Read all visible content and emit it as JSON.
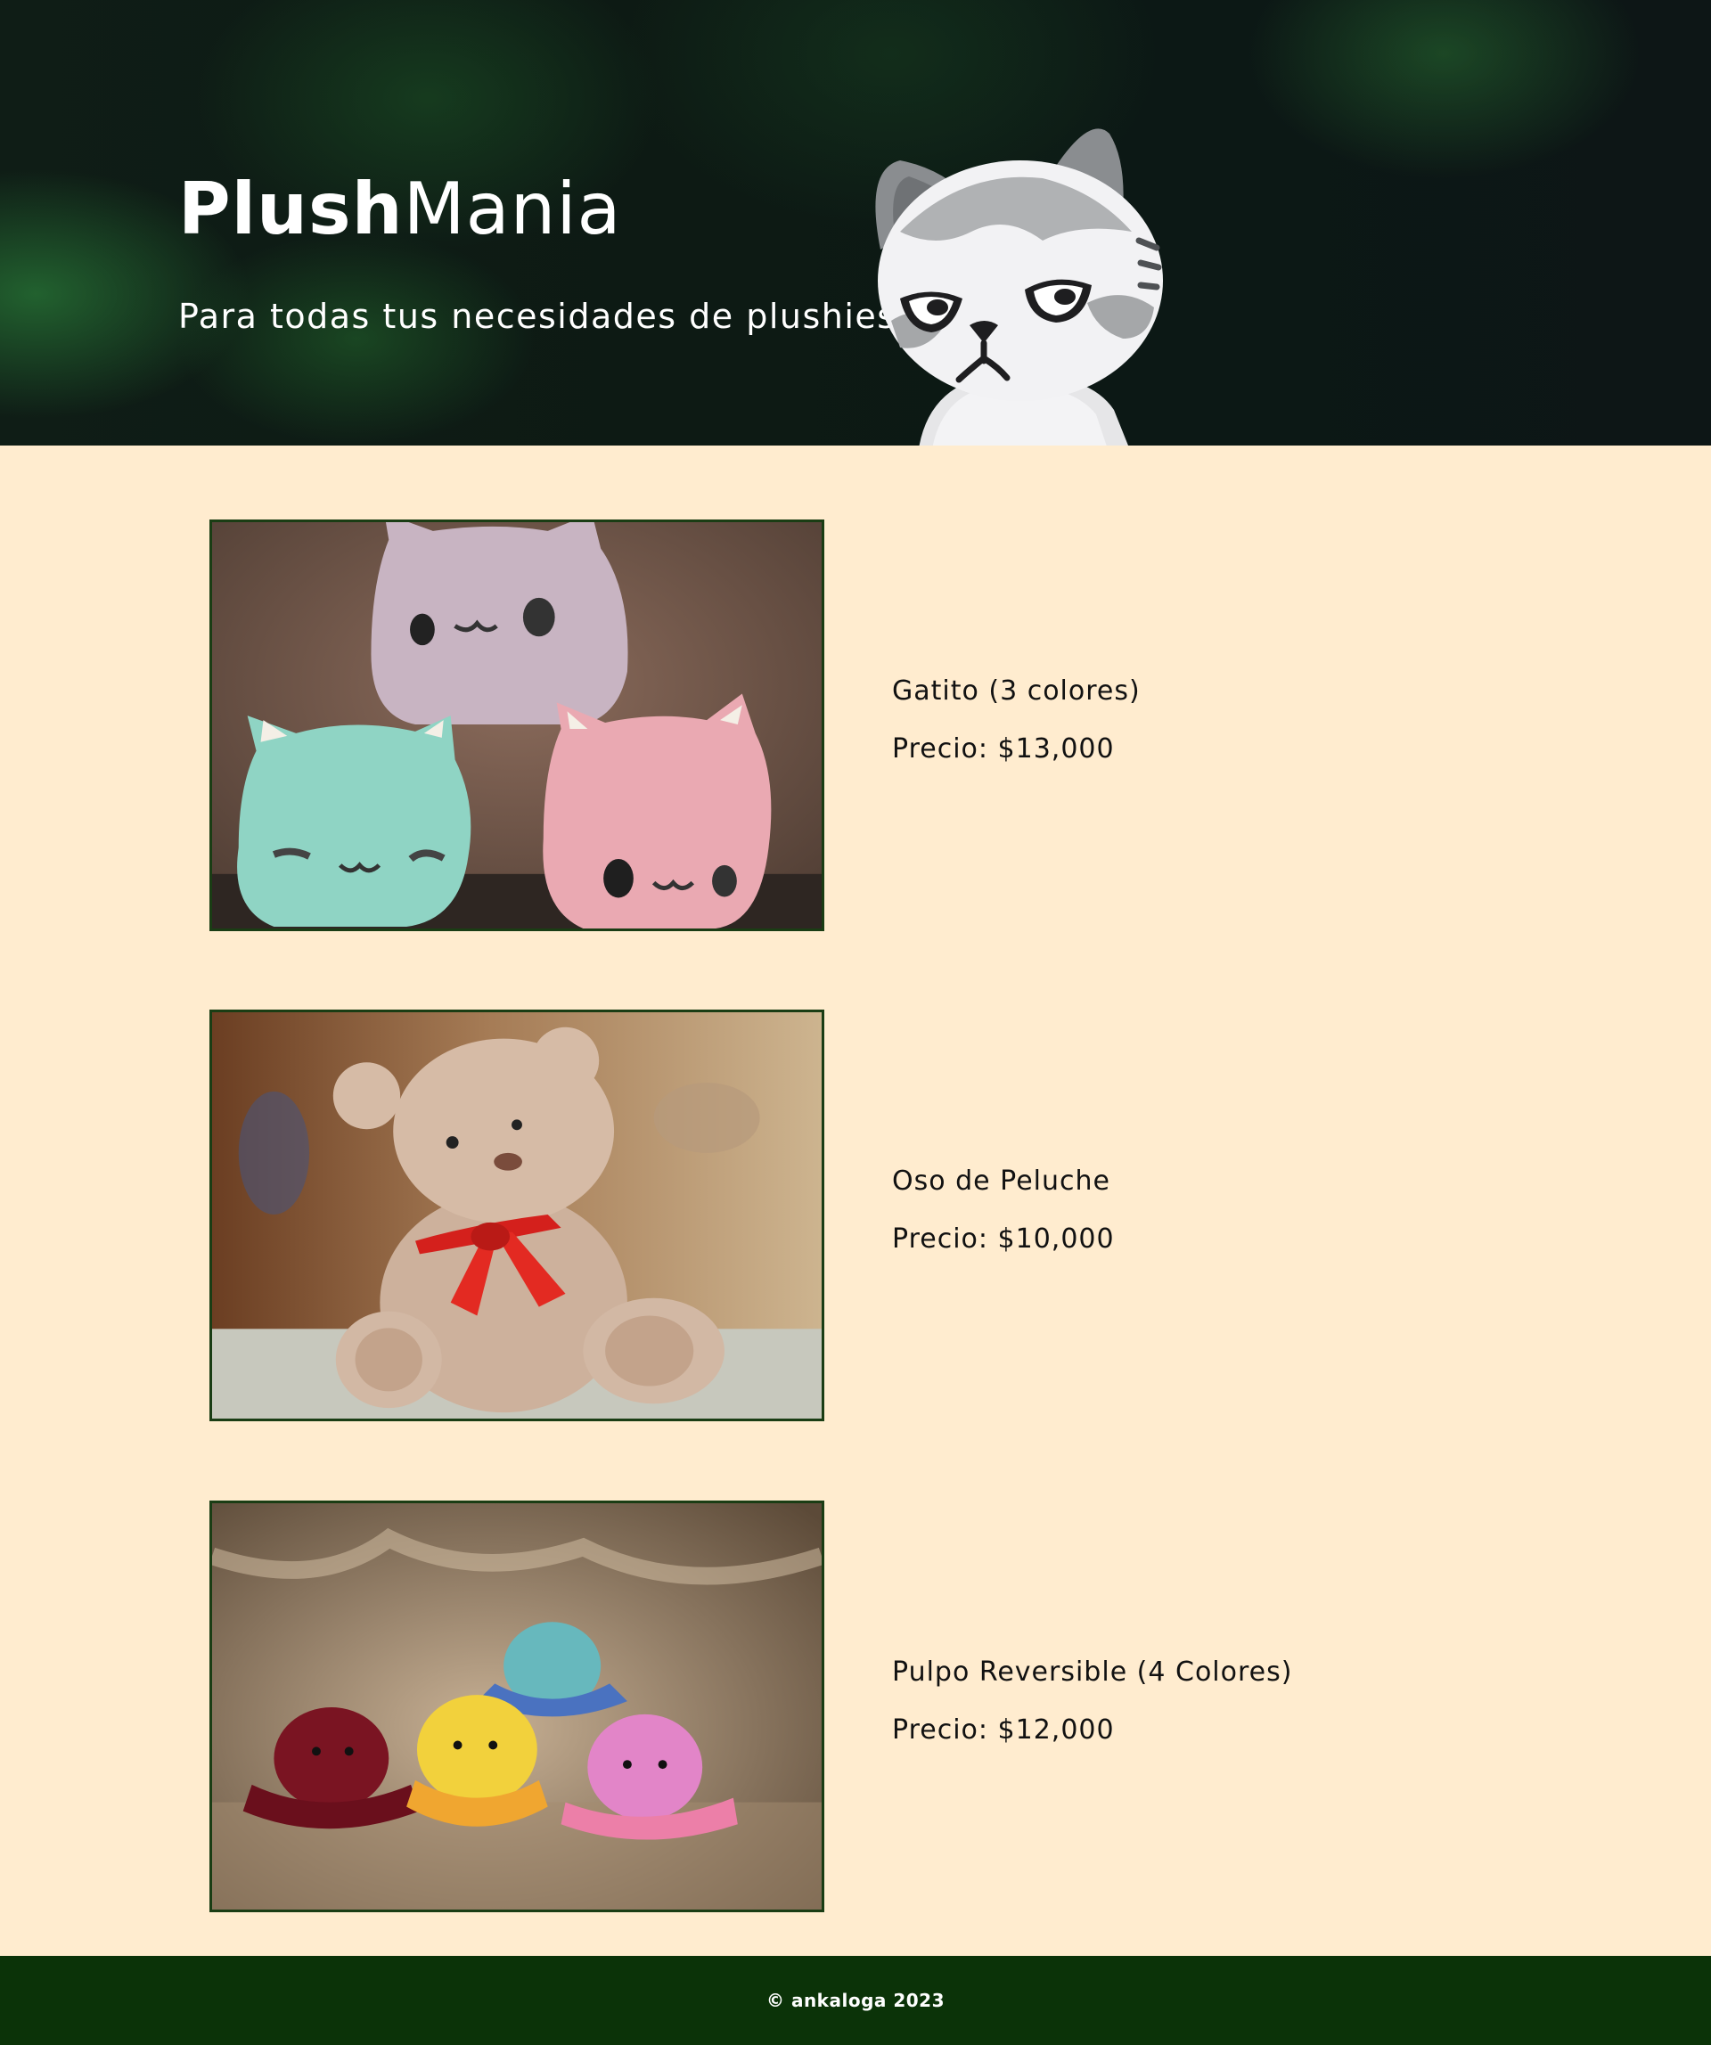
{
  "header": {
    "brand_bold": "Plush",
    "brand_light": "Mania",
    "tagline": "Para todas tus necesidades de plushies!"
  },
  "products": [
    {
      "name": "Gatito (3 colores)",
      "price": "Precio: $13,000"
    },
    {
      "name": "Oso de Peluche",
      "price": "Precio: $10,000"
    },
    {
      "name": "Pulpo Reversible (4 Colores)",
      "price": "Precio: $12,000"
    }
  ],
  "footer": {
    "copyright": "© ankaloga 2023"
  },
  "colors": {
    "page_background": "#ffeccf",
    "hero_background": "#0d1a14",
    "footer_background": "#0b3308",
    "image_border": "#1a3d14"
  }
}
